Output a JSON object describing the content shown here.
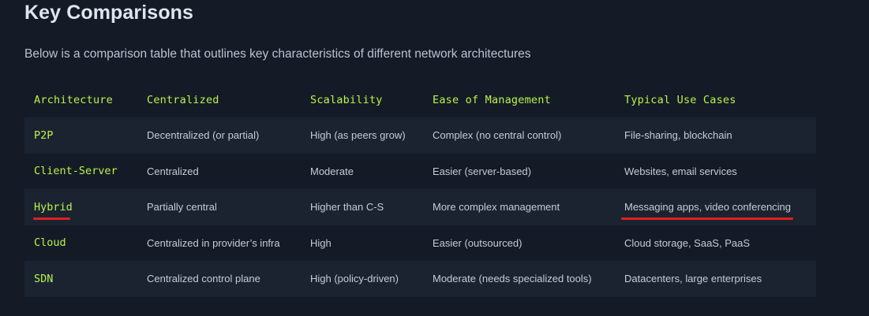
{
  "page": {
    "heading": "Key Comparisons",
    "intro": "Below is a comparison table that outlines key characteristics of different network architectures"
  },
  "table": {
    "headers": [
      "Architecture",
      "Centralized",
      "Scalability",
      "Ease of Management",
      "Typical Use Cases"
    ],
    "rows": [
      [
        "P2P",
        "Decentralized (or partial)",
        "High (as peers grow)",
        "Complex (no central control)",
        "File-sharing, blockchain"
      ],
      [
        "Client-Server",
        "Centralized",
        "Moderate",
        "Easier (server-based)",
        "Websites, email services"
      ],
      [
        "Hybrid",
        "Partially central",
        "Higher than C-S",
        "More complex management",
        "Messaging apps, video conferencing"
      ],
      [
        "Cloud",
        "Centralized in provider’s infra",
        "High",
        "Easier (outsourced)",
        "Cloud storage, SaaS, PaaS"
      ],
      [
        "SDN",
        "Centralized control plane",
        "High (policy-driven)",
        "Moderate (needs specialized tools)",
        "Datacenters, large enterprises"
      ]
    ]
  },
  "colors": {
    "background": "#141b26",
    "stripe": "#1b2331",
    "accent_green": "#b9f24a",
    "annotation_red": "#e0201c"
  }
}
